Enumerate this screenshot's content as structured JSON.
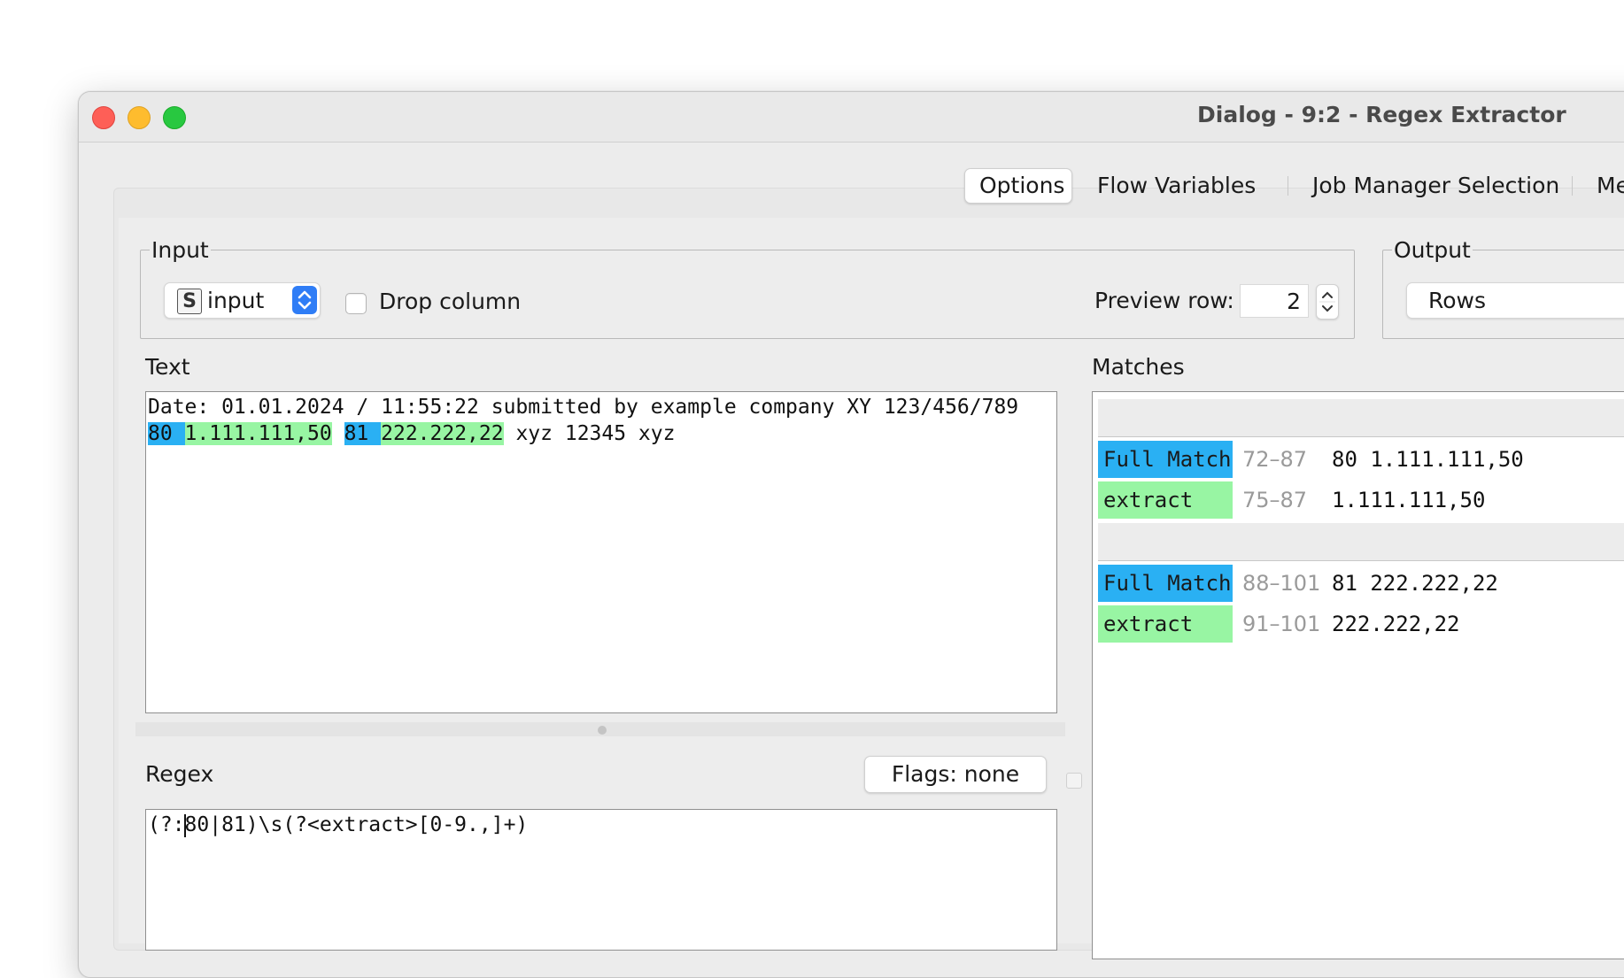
{
  "window": {
    "title": "Dialog - 9:2 - Regex Extractor"
  },
  "tabs": [
    {
      "label": "Options",
      "active": true
    },
    {
      "label": "Flow Variables"
    },
    {
      "label": "Job Manager Selection"
    },
    {
      "label": "Me"
    }
  ],
  "input_group": {
    "legend": "Input",
    "column_type_badge": "S",
    "column_value": "input",
    "drop_column_label": "Drop column",
    "drop_column_checked": false,
    "preview_row_label": "Preview row:",
    "preview_row_value": "2"
  },
  "output_group": {
    "legend": "Output",
    "mode_value": "Rows"
  },
  "text_section": {
    "label": "Text",
    "line1": "Date: 01.01.2024 / 11:55:22 submitted by example company XY 123/456/789",
    "line2_segments": [
      {
        "text": "80 ",
        "style": "full"
      },
      {
        "text": "1.111.111,50",
        "style": "extract"
      },
      {
        "text": " ",
        "style": "none"
      },
      {
        "text": "81 ",
        "style": "full"
      },
      {
        "text": "222.222,22",
        "style": "extract"
      },
      {
        "text": " xyz 12345 xyz",
        "style": "none"
      }
    ]
  },
  "regex_section": {
    "label": "Regex",
    "flags_button": "Flags: none",
    "pattern_before_caret": "(?:",
    "pattern_after_caret": "80|81)\\s(?<extract>[0-9.,]+)"
  },
  "matches_section": {
    "label": "Matches",
    "groups": [
      {
        "rows": [
          {
            "tag": "Full Match",
            "range": "72–87",
            "value": "80 1.111.111,50",
            "style": "full"
          },
          {
            "tag": "extract",
            "range": "75–87",
            "value": "1.111.111,50",
            "style": "extract"
          }
        ]
      },
      {
        "rows": [
          {
            "tag": "Full Match",
            "range": "88–101",
            "value": "81 222.222,22",
            "style": "full"
          },
          {
            "tag": "extract",
            "range": "91–101",
            "value": "222.222,22",
            "style": "extract"
          }
        ]
      }
    ]
  },
  "colors": {
    "full_match_highlight": "#2ab0f3",
    "extract_highlight": "#98f5a3",
    "accent_blue": "#2f7df6"
  },
  "icons": {
    "combo_arrows": "chevron-up-down-icon",
    "stepper": "stepper-up-down-icon"
  }
}
